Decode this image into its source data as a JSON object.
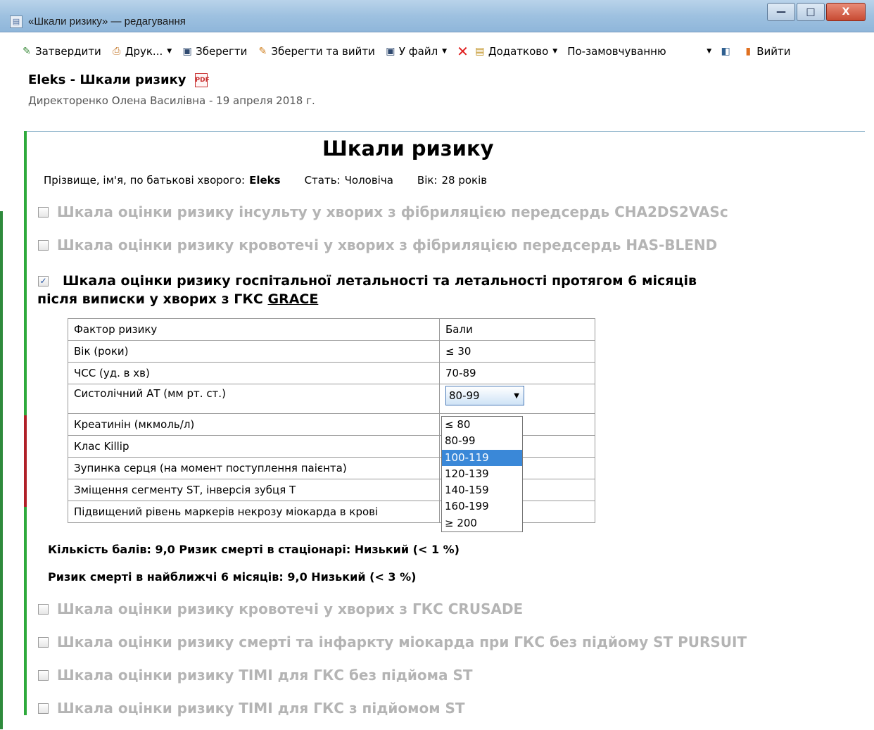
{
  "window": {
    "title": "«Шкали ризику» — редагування",
    "btn_min": "—",
    "btn_max": "□",
    "btn_close": "X"
  },
  "toolbar": {
    "approve": "Затвердити",
    "print": "Друк...",
    "save": "Зберегти",
    "save_exit": "Зберегти та вийти",
    "to_file": "У файл",
    "more": "Додатково",
    "default_select": "По-замовчуванню",
    "exit": "Вийти"
  },
  "document": {
    "title": "Eleks - Шкали ризику",
    "subtitle": "Директоренко Олена Василівна - 19 апреля 2018 г."
  },
  "main": {
    "title": "Шкали ризику",
    "patient": {
      "name_label": "Прізвище, ім'я, по батькові хворого:",
      "name": "Eleks",
      "sex_label": "Стать:",
      "sex": "Чоловіча",
      "age_label": "Вік:",
      "age": "28 років"
    },
    "scales_top": [
      {
        "label": "Шкала оцінки ризику інсульту у хворих з фібриляцією передсердь CHA2DS2VASc",
        "checked": false
      },
      {
        "label": "Шкала оцінки ризику кровотечі у хворих з фібриляцією передсердь HAS-BLEND",
        "checked": false
      }
    ],
    "grace": {
      "label_line1": "Шкала оцінки ризику госпітальної летальності та летальності протягом 6 місяців",
      "label_line2": "після виписки у хворих з ГКС",
      "label_link": "GRACE",
      "checked": true,
      "header": {
        "factor": "Фактор ризику",
        "points": "Бали"
      },
      "rows": [
        {
          "factor": "Вік (роки)",
          "value": "≤ 30"
        },
        {
          "factor": "ЧСС (уд. в хв)",
          "value": "70-89"
        },
        {
          "factor": "Систолічний АТ (мм рт. ст.)",
          "value": "80-99"
        },
        {
          "factor": "Креатинін (мкмоль/л)",
          "value": ""
        },
        {
          "factor": "Клас Killip",
          "value": ""
        },
        {
          "factor": "Зупинка серця (на момент поступлення паієнта)",
          "value": ""
        },
        {
          "factor": "Зміщення  сегменту ST, інверсія зубця T",
          "value": ""
        },
        {
          "factor": "Підвищений рівень маркерів некрозу міокарда в крові",
          "value": ""
        }
      ],
      "dropdown_options": [
        "≤ 80",
        "80-99",
        "100-119",
        "120-139",
        "140-159",
        "160-199",
        "≥ 200"
      ],
      "dropdown_highlighted": "100-119",
      "summary1": "Кількість балів: 9,0   Ризик смерті в стаціонарі: Низький (< 1 %)",
      "summary2": "Ризик смерті в найближчі 6 місяців: 9,0   Низький (< 3 %)"
    },
    "scales_bottom": [
      {
        "label": "Шкала оцінки ризику кровотечі у хворих з ГКС CRUSADE",
        "checked": false
      },
      {
        "label": "Шкала оцінки ризику смерті та інфаркту міокарда при ГКС без підйому ST PURSUIT",
        "checked": false
      },
      {
        "label": "Шкала оцінки ризику TIMI  для ГКС без підйома ST",
        "checked": false
      },
      {
        "label": "Шкала оцінки ризику TIMI  для ГКС з підйомом ST",
        "checked": false
      }
    ]
  }
}
